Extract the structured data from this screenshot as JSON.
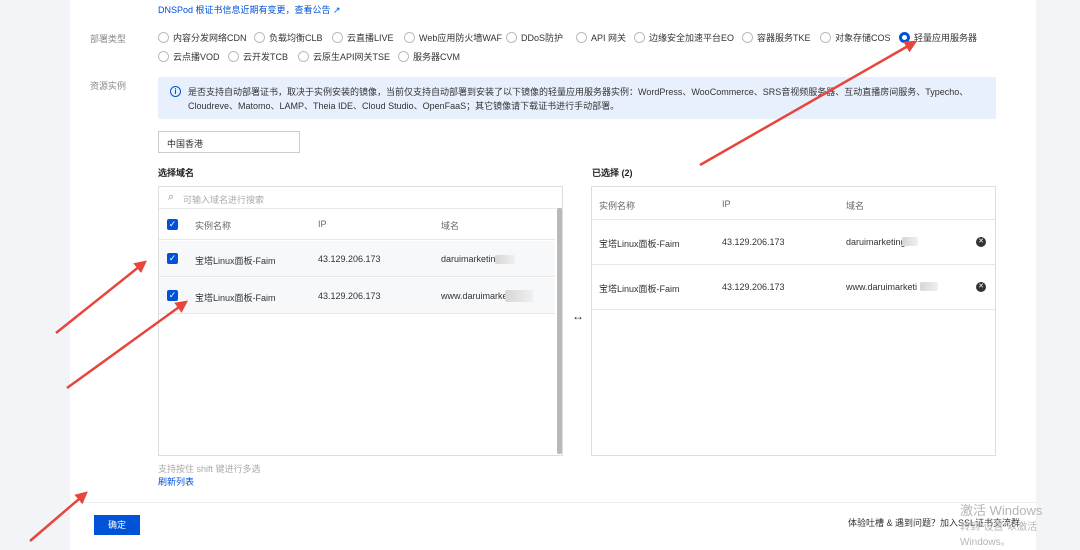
{
  "notice_top": {
    "text": "DNSPod 根证书信息近期有变更，查看公告",
    "icon": "external-link-icon"
  },
  "deploy_type": {
    "label": "部署类型",
    "options": [
      "内容分发网络CDN",
      "负载均衡CLB",
      "云直播LIVE",
      "Web应用防火墙WAF",
      "DDoS防护",
      "API 网关",
      "边缘安全加速平台EO",
      "容器服务TKE",
      "对象存储COS",
      "轻量应用服务器",
      "云点播VOD",
      "云开发TCB",
      "云原生API网关TSE",
      "服务器CVM"
    ],
    "selected": "轻量应用服务器"
  },
  "resource": {
    "label": "资源实例",
    "notice": "是否支持自动部署证书，取决于实例安装的镜像，当前仅支持自动部署到安装了以下镜像的轻量应用服务器实例：WordPress、WooCommerce、SRS音视频服务器、互动直播房间服务、Typecho、Cloudreve、Matomo、LAMP、Theia IDE、Cloud Studio、OpenFaaS；其它镜像请下载证书进行手动部署。",
    "region": "中国香港"
  },
  "select_domain": {
    "title": "选择域名",
    "search_placeholder": "可输入域名进行搜索",
    "columns": [
      "实例名称",
      "IP",
      "域名"
    ],
    "rows": [
      {
        "name": "宝塔Linux面板-Faim",
        "ip": "43.129.206.173",
        "domain": "daruimarketin"
      },
      {
        "name": "宝塔Linux面板-Faim",
        "ip": "43.129.206.173",
        "domain": "www.daruimarke"
      }
    ],
    "hint": "支持按住 shift 键进行多选",
    "refresh": "刷新列表"
  },
  "transfer_icon": "↔",
  "selected": {
    "title": "已选择 (2)",
    "columns": [
      "实例名称",
      "IP",
      "域名"
    ],
    "rows": [
      {
        "name": "宝塔Linux面板-Faim",
        "ip": "43.129.206.173",
        "domain": "daruimarketing"
      },
      {
        "name": "宝塔Linux面板-Faim",
        "ip": "43.129.206.173",
        "domain": "www.daruimarketi"
      }
    ]
  },
  "footer": {
    "confirm": "确定",
    "feedback": "体验吐槽 & 遇到问题？加入SSL证书交流群"
  },
  "watermark": {
    "line1": "激活 Windows",
    "line2": "转到\"设置\"以激活 Windows。"
  },
  "colors": {
    "accent": "#0052d9",
    "arrow": "#e8453c"
  }
}
